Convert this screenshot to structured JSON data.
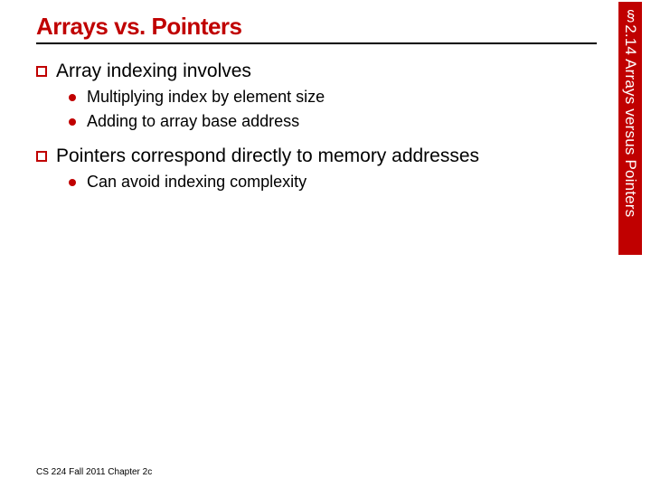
{
  "title": "Arrays vs. Pointers",
  "sidebar": "§2.14 Arrays versus Pointers",
  "bullets": {
    "b1": "Array indexing involves",
    "b1a": "Multiplying index by element size",
    "b1b": "Adding to array base address",
    "b2": "Pointers correspond directly to memory addresses",
    "b2a": "Can avoid indexing complexity"
  },
  "footer": "CS 224 Fall 2011 Chapter 2c"
}
